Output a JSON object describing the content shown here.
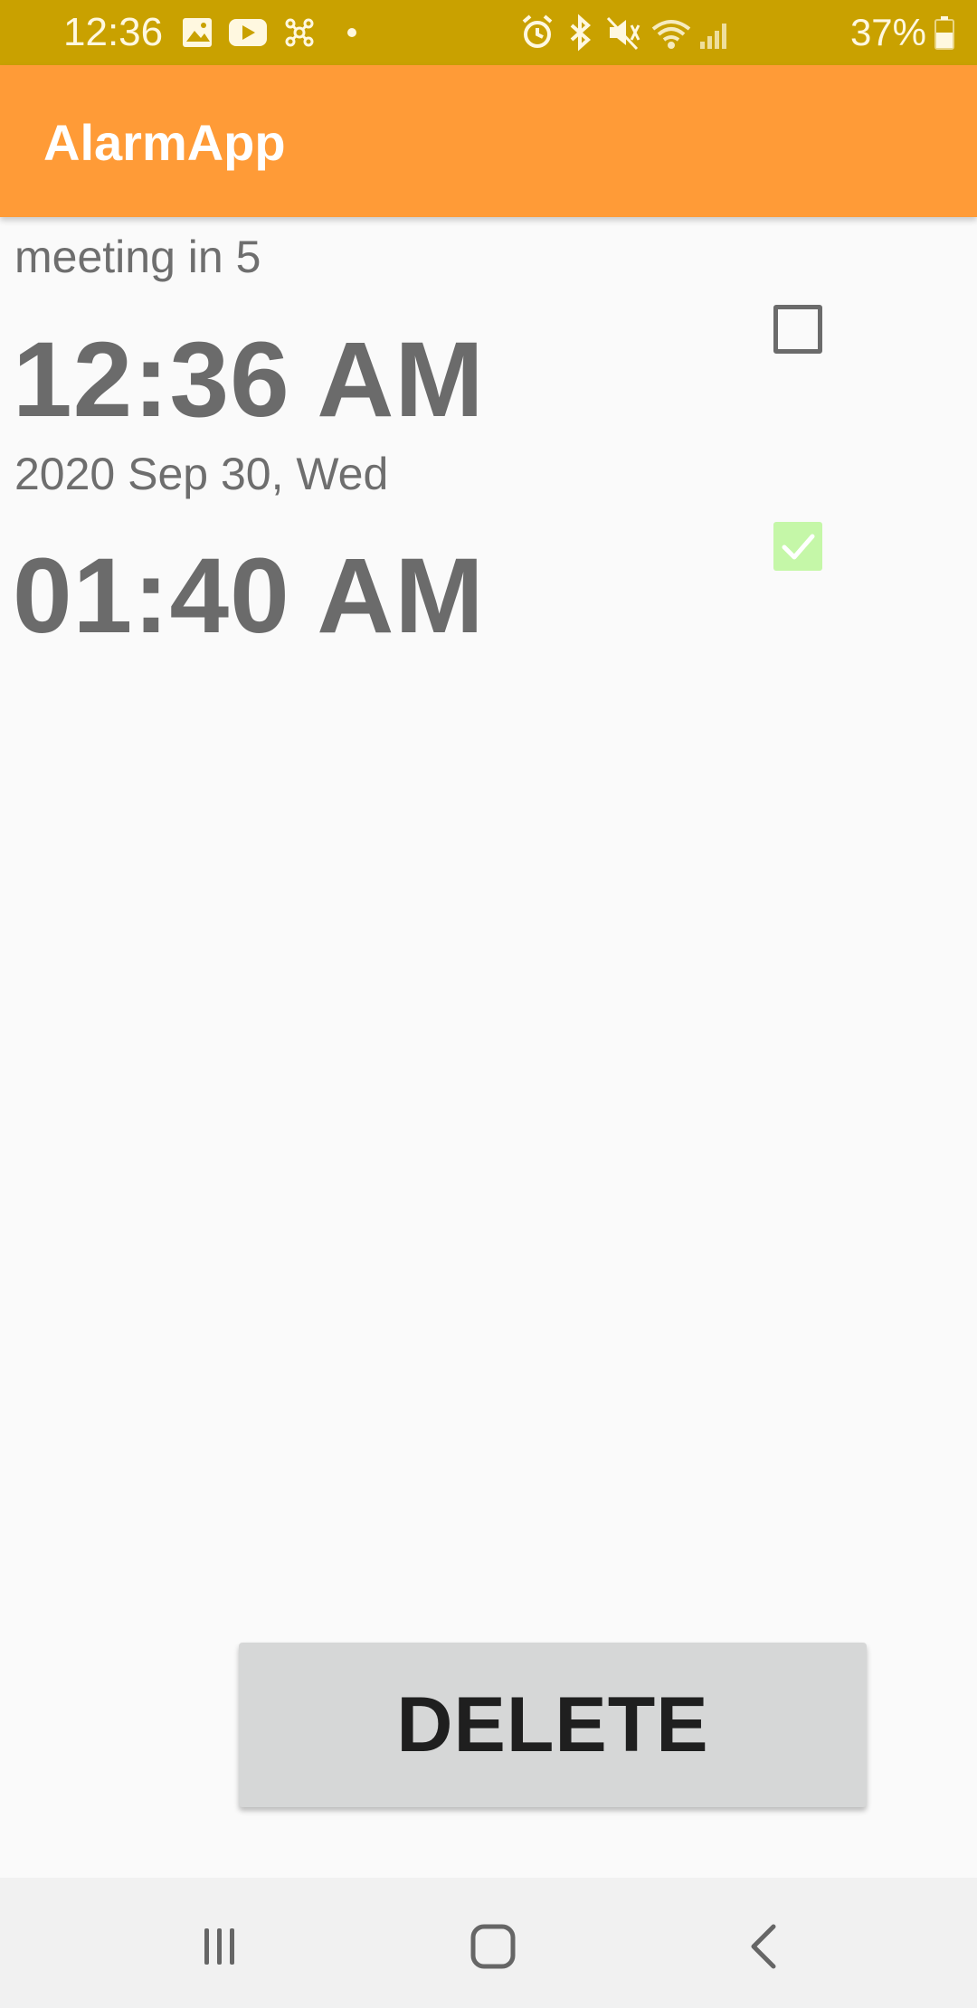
{
  "status_bar": {
    "time": "12:36",
    "battery_percent": "37%",
    "left_icons": [
      "gallery-icon",
      "youtube-icon",
      "network-icon",
      "dot-icon"
    ],
    "right_icons": [
      "alarm-icon",
      "bluetooth-icon",
      "mute-icon",
      "wifi-icon",
      "signal-icon",
      "battery-icon"
    ]
  },
  "app_bar": {
    "title": "AlarmApp",
    "color": "#ff9b37"
  },
  "alarms": [
    {
      "label": "meeting in 5",
      "time": "12:36 AM",
      "date": "2020 Sep 30, Wed",
      "checked": false
    },
    {
      "label": "",
      "time": "01:40 AM",
      "date": "",
      "checked": true
    }
  ],
  "delete_button": {
    "label": "DELETE"
  },
  "nav_bar": {
    "icons": [
      "recents-icon",
      "home-icon",
      "back-icon"
    ]
  }
}
